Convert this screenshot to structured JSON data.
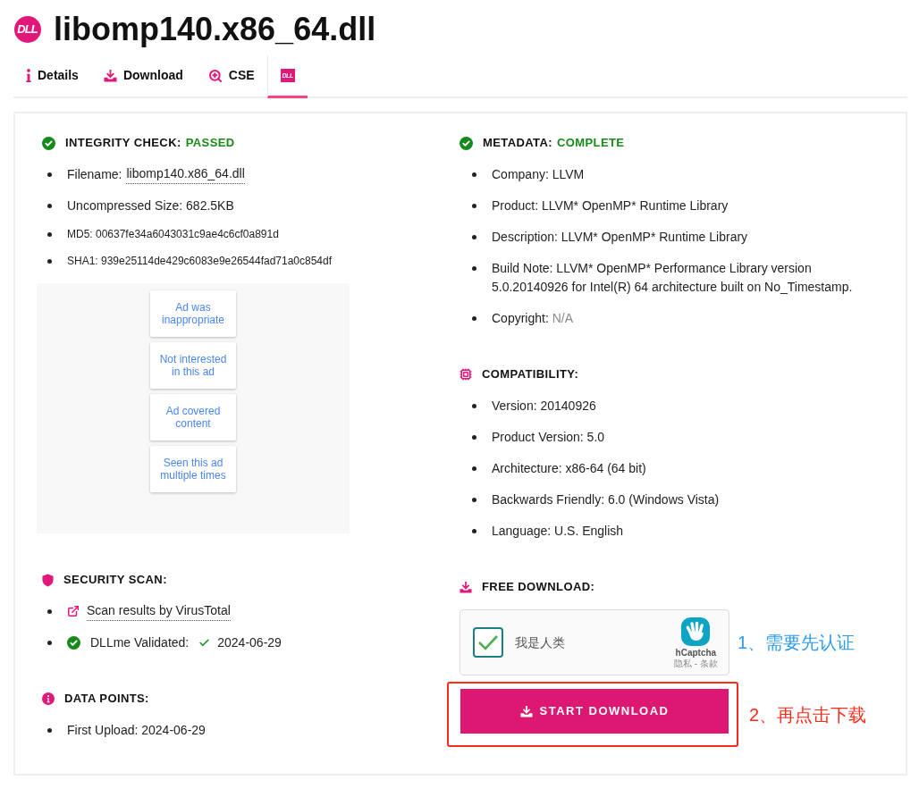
{
  "header": {
    "logo_text": "DLL",
    "title": "libomp140.x86_64.dll"
  },
  "tabs": [
    {
      "kind": "text",
      "label": "Details",
      "selected": false
    },
    {
      "kind": "text",
      "label": "Download",
      "selected": false
    },
    {
      "kind": "text",
      "label": "CSE",
      "selected": false
    },
    {
      "kind": "logo",
      "logo_text": "DLL",
      "selected": true
    }
  ],
  "integrity_check": {
    "title": "INTEGRITY CHECK:",
    "status": "PASSED",
    "items": [
      {
        "kind": "link",
        "label": "Filename:",
        "value": "libomp140.x86_64.dll"
      },
      {
        "kind": "plain",
        "text": "Uncompressed Size: 682.5KB"
      },
      {
        "kind": "small",
        "text": "MD5: 00637fe34a6043031c9ae4c6cf0a891d"
      },
      {
        "kind": "small",
        "text": "SHA1: 939e25114de429c6083e9e26544fad71a0c854df"
      }
    ]
  },
  "ad_feedback": {
    "options": [
      "Ad was inappropriate",
      "Not interested in this ad",
      "Ad covered content",
      "Seen this ad multiple times"
    ]
  },
  "security_scan": {
    "title": "SECURITY SCAN:",
    "items": [
      {
        "kind": "external_link",
        "text": "Scan results by VirusTotal"
      },
      {
        "kind": "validated",
        "label": "DLLme Validated:",
        "value": "2024-06-29"
      }
    ]
  },
  "data_points": {
    "title": "DATA POINTS:",
    "items": [
      {
        "kind": "plain",
        "text": "First Upload: 2024-06-29"
      }
    ]
  },
  "metadata": {
    "title": "METADATA:",
    "status": "COMPLETE",
    "items": [
      {
        "kind": "plain",
        "text": "Company: LLVM"
      },
      {
        "kind": "plain",
        "text": "Product: LLVM* OpenMP* Runtime Library"
      },
      {
        "kind": "plain",
        "text": "Description: LLVM* OpenMP* Runtime Library"
      },
      {
        "kind": "plain",
        "text": "Build Note: LLVM* OpenMP* Performance Library version 5.0.20140926 for Intel(R) 64 architecture built on No_Timestamp."
      },
      {
        "kind": "muted",
        "label": "Copyright:",
        "value": "N/A"
      }
    ]
  },
  "compatibility": {
    "title": "COMPATIBILITY:",
    "items": [
      {
        "kind": "plain",
        "text": "Version: 20140926"
      },
      {
        "kind": "plain",
        "text": "Product Version: 5.0"
      },
      {
        "kind": "plain",
        "text": "Architecture: x86-64 (64 bit)"
      },
      {
        "kind": "plain",
        "text": "Backwards Friendly: 6.0 (Windows Vista)"
      },
      {
        "kind": "plain",
        "text": "Language: U.S. English"
      }
    ]
  },
  "free_download": {
    "title": "FREE DOWNLOAD:",
    "captcha": {
      "checked": true,
      "label": "我是人类",
      "brand": "hCaptcha",
      "links": [
        "隐私",
        "条款"
      ],
      "separator": "-"
    },
    "button": {
      "label": "START DOWNLOAD"
    }
  },
  "annotations": [
    {
      "text": "1、需要先认证",
      "color": "#2e9bf0"
    },
    {
      "text": "2、再点击下载",
      "color": "#ff2a1a"
    }
  ]
}
